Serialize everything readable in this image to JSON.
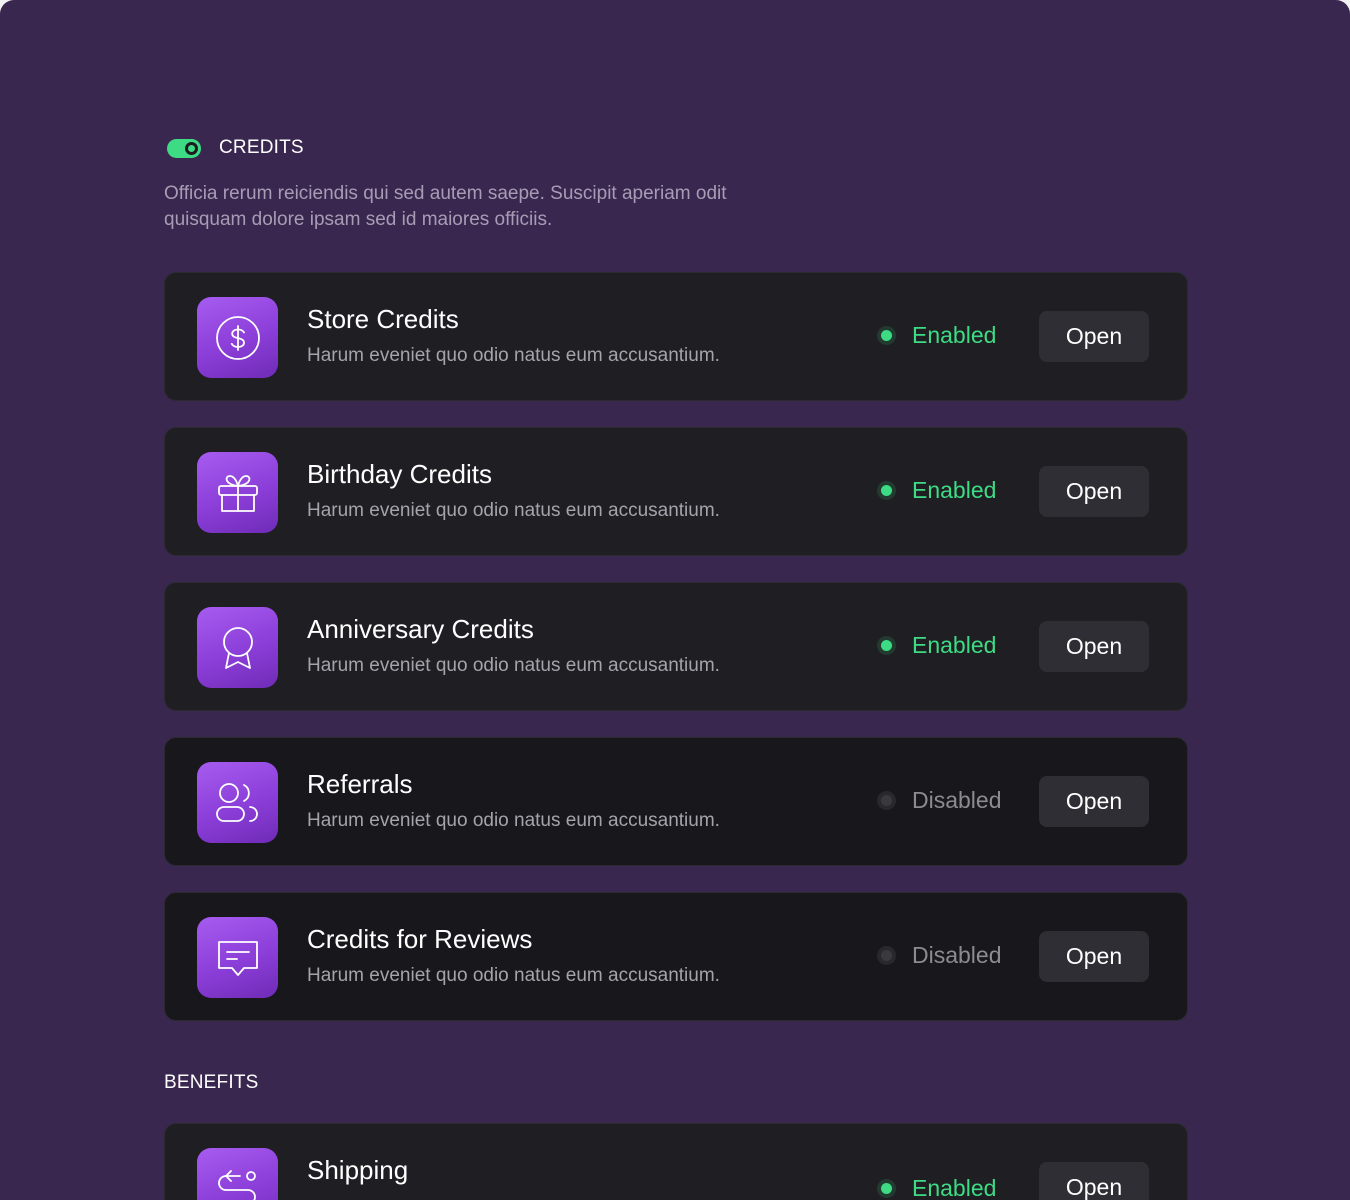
{
  "credits_section": {
    "title": "CREDITS",
    "toggle_on": true,
    "description": "Officia rerum reiciendis qui sed autem saepe. Suscipit aperiam odit quisquam dolore ipsam sed id maiores officiis."
  },
  "cards": [
    {
      "title": "Store Credits",
      "description": "Harum eveniet quo odio natus eum accusantium.",
      "status": "Enabled",
      "button": "Open",
      "icon": "dollar-coin-icon"
    },
    {
      "title": "Birthday Credits",
      "description": "Harum eveniet quo odio natus eum accusantium.",
      "status": "Enabled",
      "button": "Open",
      "icon": "gift-icon"
    },
    {
      "title": "Anniversary Credits",
      "description": "Harum eveniet quo odio natus eum accusantium.",
      "status": "Enabled",
      "button": "Open",
      "icon": "award-ribbon-icon"
    },
    {
      "title": "Referrals",
      "description": "Harum eveniet quo odio natus eum accusantium.",
      "status": "Disabled",
      "button": "Open",
      "icon": "users-icon"
    },
    {
      "title": "Credits for Reviews",
      "description": "Harum eveniet quo odio natus eum accusantium.",
      "status": "Disabled",
      "button": "Open",
      "icon": "chat-message-icon"
    }
  ],
  "benefits_section": {
    "title": "BENEFITS"
  },
  "benefit_cards": [
    {
      "title": "Shipping",
      "status": "Enabled",
      "button": "Open",
      "icon": "route-icon"
    }
  ],
  "colors": {
    "background": "#3a2750",
    "card": "#1f1e23",
    "accent_purple": "#8b3ed8",
    "enabled_green": "#3ddc84",
    "disabled_gray": "#8d8b92"
  }
}
